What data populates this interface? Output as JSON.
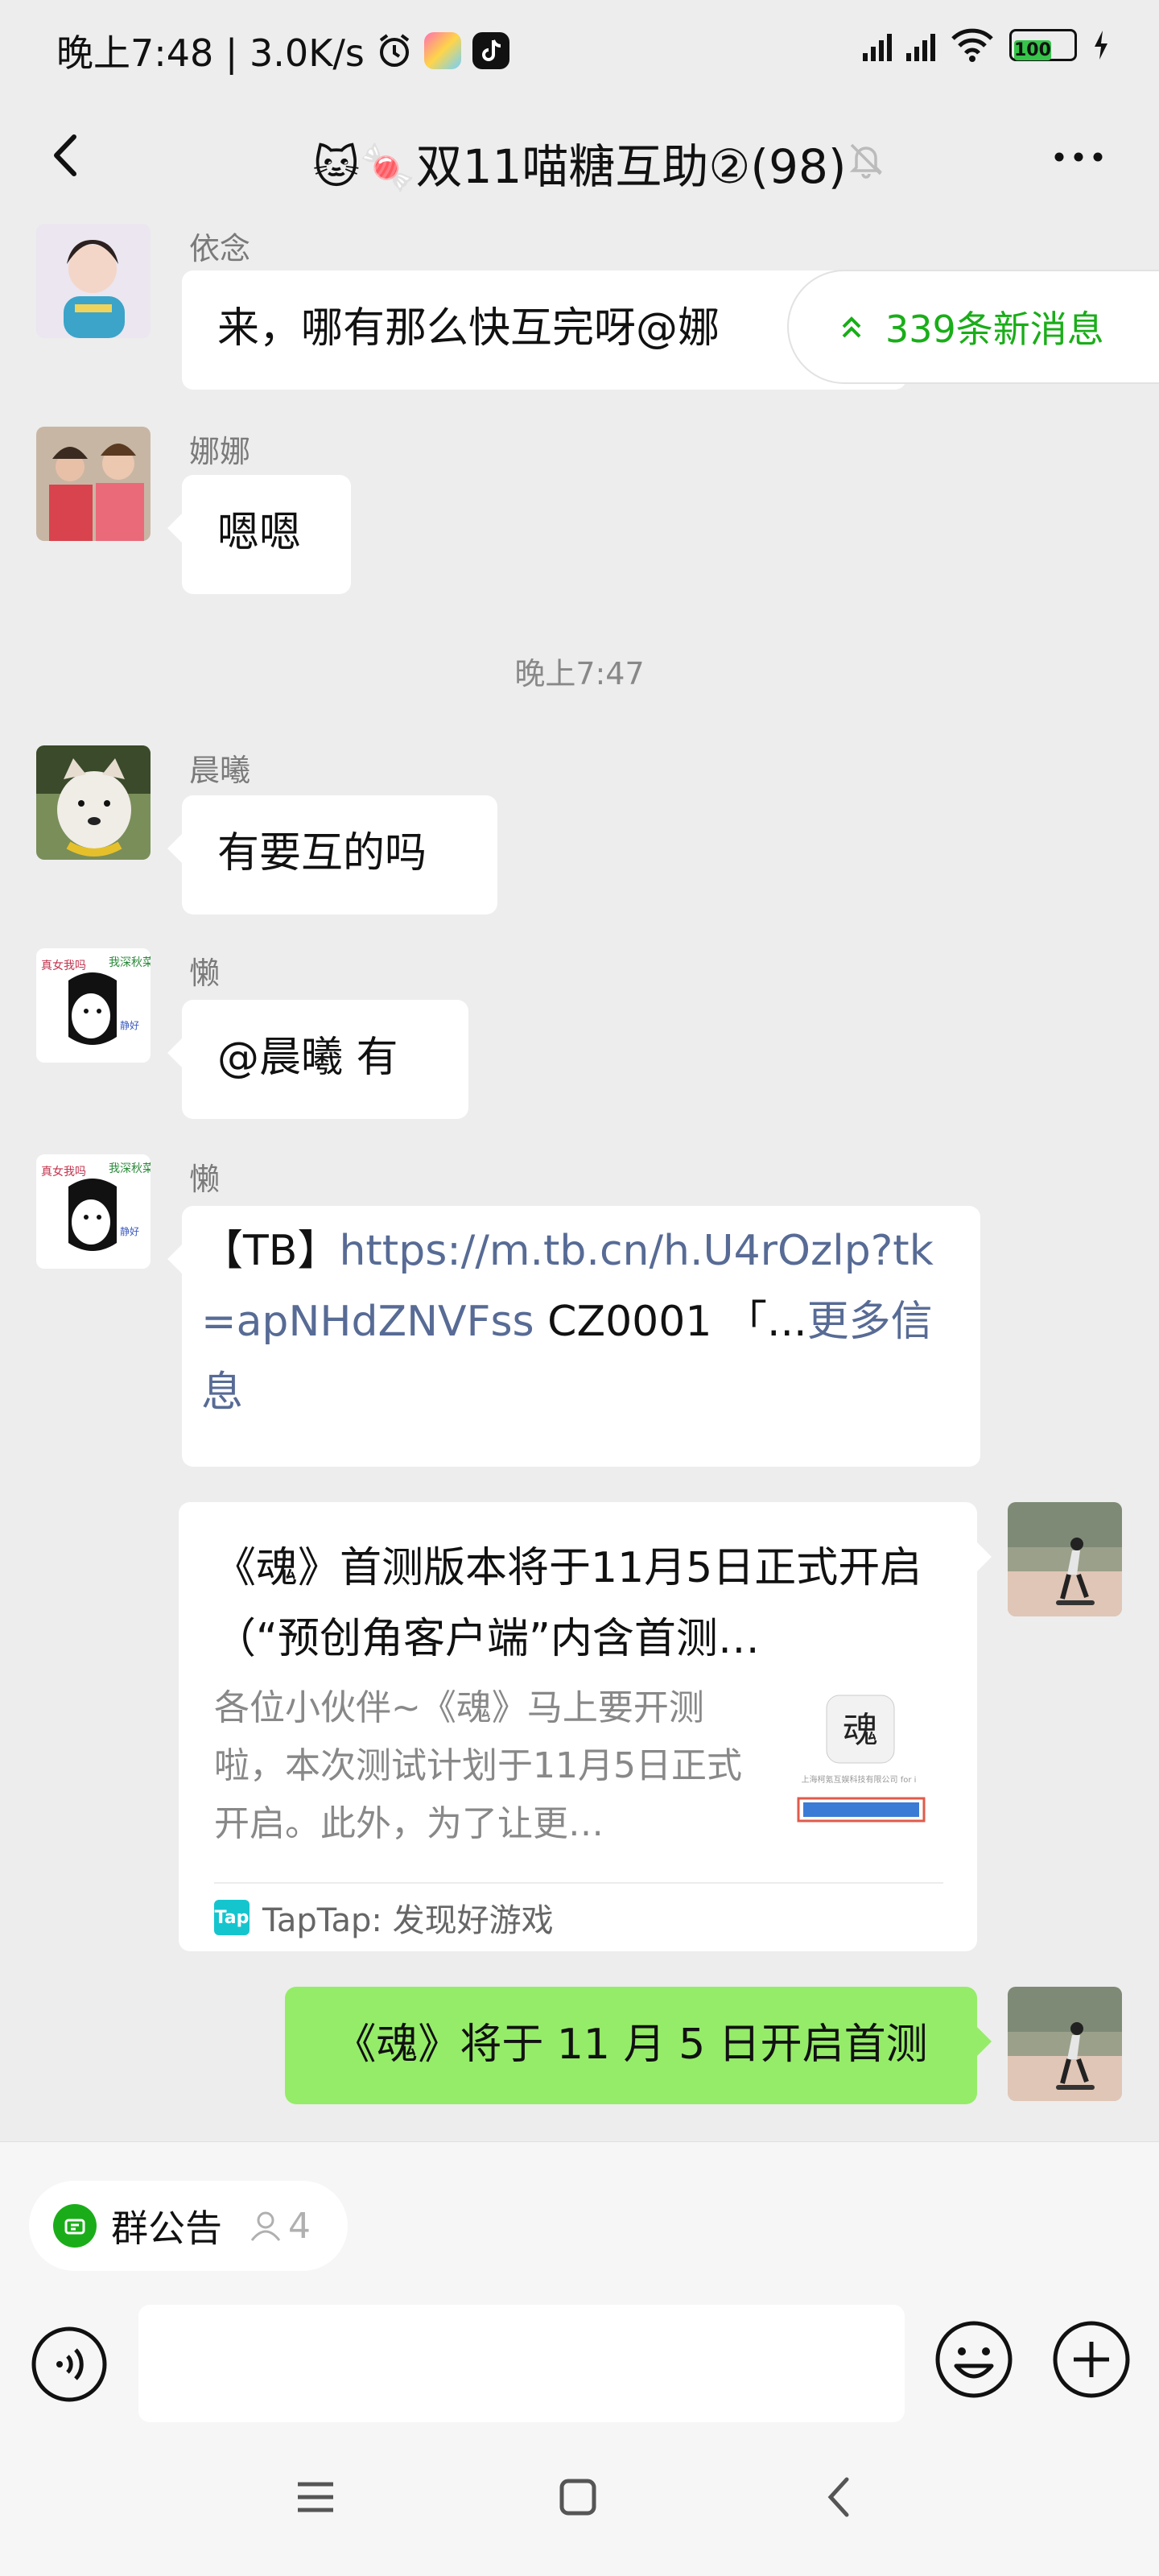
{
  "status_bar": {
    "time_speed": "晚上7:48 | 3.0K/s",
    "battery": "100"
  },
  "header": {
    "title": "双11喵糖互助②(98)",
    "title_emoji": "🐱🍬"
  },
  "new_messages_pill": "339条新消息",
  "messages": [
    {
      "name": "依念",
      "text": "来，哪有那么快互完呀@娜"
    },
    {
      "name": "娜娜",
      "text": "嗯嗯"
    },
    {
      "timestamp": "晚上7:47"
    },
    {
      "name": "晨曦",
      "text": "有要互的吗"
    },
    {
      "name": "懒",
      "text": "@晨曦  有"
    },
    {
      "name": "懒",
      "prefix": "【TB】",
      "link": "https://m.tb.cn/h.U4rOzlp?tk=apNHdZNVFss",
      "suffix": " CZ0001 「...",
      "more": "更多信息"
    }
  ],
  "card": {
    "title": "《魂》首测版本将于11月5日正式开启（“预创角客户端”内含首测…",
    "desc": "各位小伙伴~《魂》马上要开测啦，本次测试计划于11月5日正式开启。此外，为了让更…",
    "thumb_char": "魂",
    "thumb_caption": "上海柯氪互娱科技有限公司 for i",
    "source_logo": "Tap",
    "source": "TapTap: 发现好游戏"
  },
  "my_message": "《魂》将于 11 月 5 日开启首测",
  "bottom": {
    "notice_label": "群公告",
    "notice_count": "4"
  },
  "colors": {
    "accent_green": "#1aad19",
    "my_bubble": "#95ec69",
    "link": "#576b95"
  }
}
